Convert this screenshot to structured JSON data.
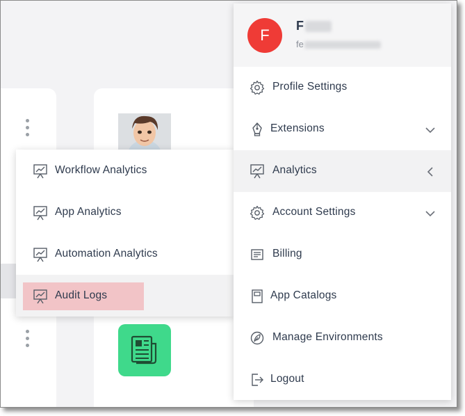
{
  "user": {
    "initial": "F",
    "name": "F",
    "email": "fe"
  },
  "menu": {
    "items": [
      {
        "label": "Profile Settings",
        "icon": "gear-icon"
      },
      {
        "label": "Extensions",
        "icon": "pen-nib-icon",
        "expand": "chevron-down-icon"
      },
      {
        "label": "Analytics",
        "icon": "analytics-board-icon",
        "expand": "chevron-left-icon",
        "active": true
      },
      {
        "label": "Account Settings",
        "icon": "gear-icon",
        "expand": "chevron-down-icon"
      },
      {
        "label": "Billing",
        "icon": "receipt-icon"
      },
      {
        "label": "App Catalogs",
        "icon": "catalog-icon"
      },
      {
        "label": "Manage Environments",
        "icon": "leaf-icon"
      },
      {
        "label": "Logout",
        "icon": "logout-icon"
      }
    ]
  },
  "submenu": {
    "items": [
      {
        "label": "Workflow Analytics",
        "icon": "analytics-board-icon"
      },
      {
        "label": "App Analytics",
        "icon": "analytics-board-icon"
      },
      {
        "label": "Automation Analytics",
        "icon": "analytics-board-icon"
      },
      {
        "label": "Audit Logs",
        "icon": "analytics-board-icon",
        "highlighted": true
      }
    ]
  },
  "colors": {
    "avatar_bg": "#ef3b36",
    "highlight": "#f2c4c7",
    "app_tile": "#3fd98b",
    "text": "#2e3a4d"
  }
}
